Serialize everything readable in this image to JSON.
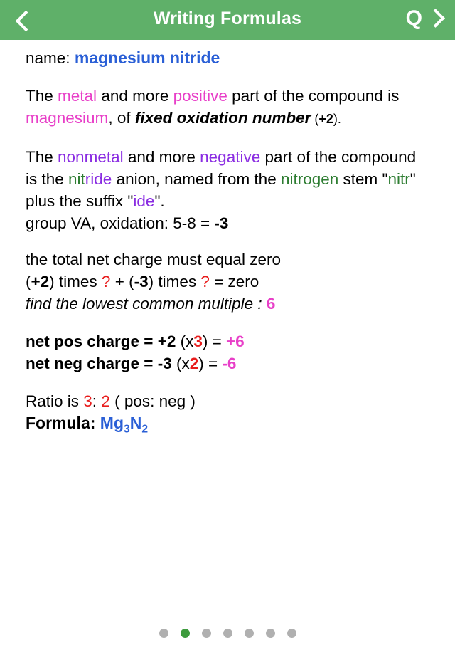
{
  "header": {
    "title": "Writing Formulas",
    "back_icon": "chevron-left-icon",
    "quiz_label": "Q",
    "forward_icon": "chevron-right-icon",
    "background_color": "#5fb069"
  },
  "colors": {
    "blue": "#2a5fd6",
    "magenta": "#e83fc8",
    "purple": "#8a2ce2",
    "green": "#2e7d32",
    "red": "#e81c1c",
    "active_dot": "#3d9b3d",
    "inactive_dot": "#b0b0b0"
  },
  "lesson": {
    "name_label": "name:",
    "compound_name": "magnesium nitride",
    "metal_para": {
      "t1": "The ",
      "metal": "metal",
      "t2": " and more ",
      "positive": "positive",
      "t3": " part of the compound is ",
      "element": "magnesium",
      "t4": ", of ",
      "emph": "fixed oxidation number",
      "t5": " (",
      "oxnum": "+2",
      "t6": ")."
    },
    "nonmetal_para": {
      "t1": "The ",
      "nonmetal": "nonmetal",
      "t2": " and more ",
      "negative": "negative",
      "t3": " part of the compound is the ",
      "anion_stem": "nit",
      "anion_suffix": "ride",
      "t4": " anion, named from the ",
      "element": "nitrogen",
      "t5": " stem \"",
      "stem": "nitr",
      "t6": "\" plus the suffix \"",
      "suffix": "ide",
      "t7": "\"."
    },
    "group_line": {
      "t1": "group VA, oxidation: 5-8 = ",
      "value": "-3"
    },
    "charge_rule": "the total net charge must equal zero",
    "equation": {
      "t1": "(",
      "pos": "+2",
      "t2": ") times ",
      "q1": "?",
      "t3": "  + (",
      "neg": "-3",
      "t4": ") times ",
      "q2": "?",
      "t5": " = zero"
    },
    "lcm_line": {
      "label": "find the lowest common multiple : ",
      "value": "6"
    },
    "net_pos": {
      "label": "net pos charge",
      "t1": " = ",
      "charge": "+2",
      "t2": " (x",
      "mult": "3",
      "t3": ") = ",
      "result": "+6"
    },
    "net_neg": {
      "label": "net neg charge",
      "t1": " = ",
      "charge": "-3",
      "t2": " (x",
      "mult": "2",
      "t3": ") = ",
      "result": "-6"
    },
    "ratio": {
      "t1": "Ratio is ",
      "a": "3",
      "t2": ": ",
      "b": "2",
      "t3": " ( pos: neg )"
    },
    "formula": {
      "label": "Formula:",
      "sym1": "Mg",
      "sub1": "3",
      "sym2": "N",
      "sub2": "2"
    }
  },
  "pager": {
    "total": 7,
    "active_index": 1
  }
}
